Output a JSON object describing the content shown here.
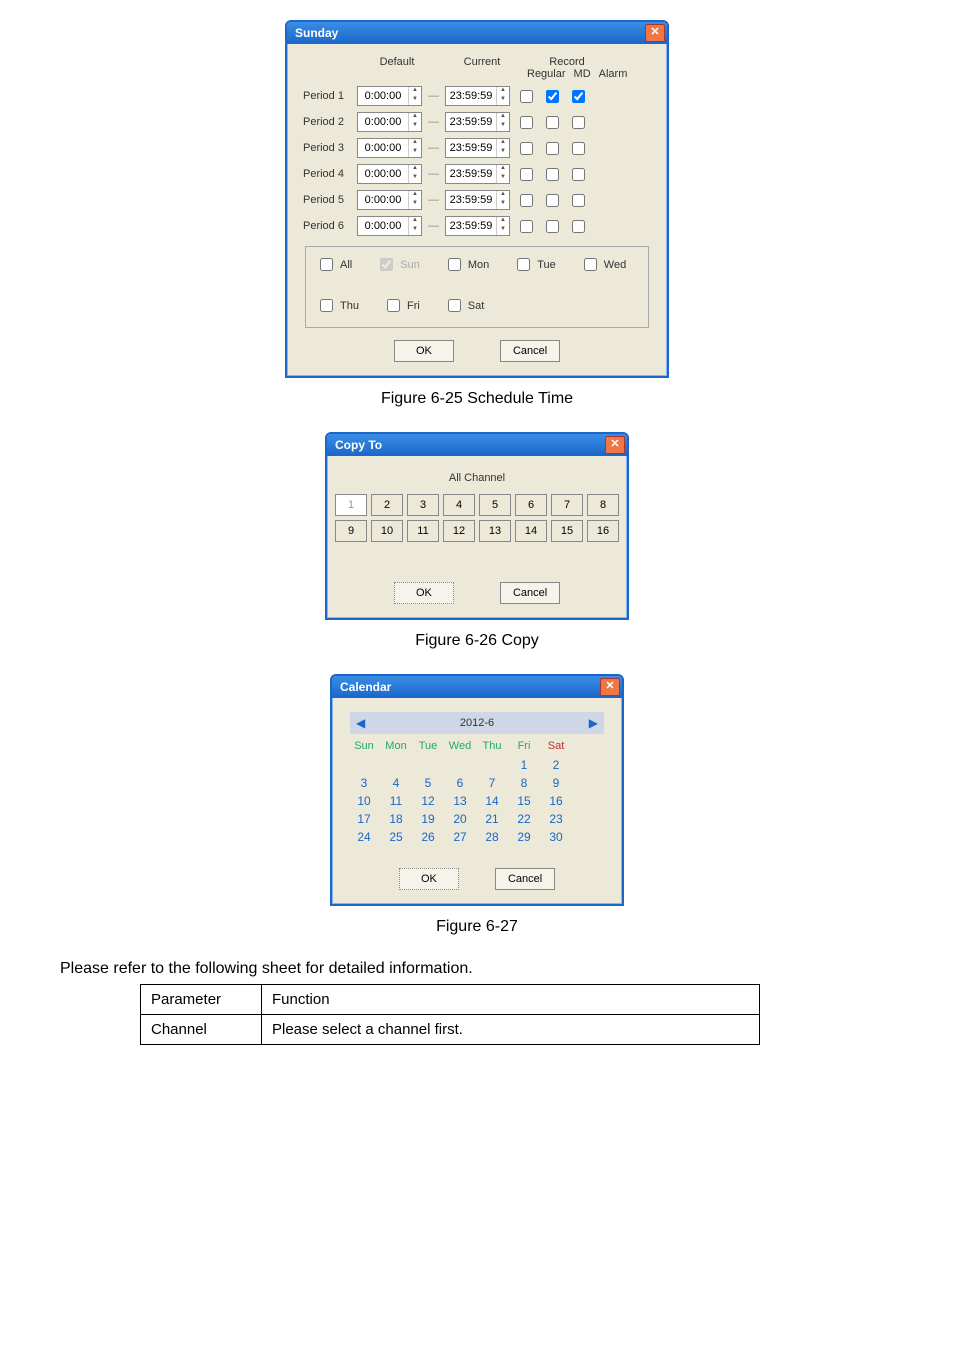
{
  "fig25": {
    "title": "Sunday",
    "cols": {
      "default": "Default",
      "current": "Current",
      "record": "Record",
      "regular": "Regular",
      "md": "MD",
      "alarm": "Alarm"
    },
    "rows": [
      {
        "label": "Period 1",
        "from": "0:00:00",
        "to": "23:59:59",
        "reg": false,
        "md": true,
        "al": true
      },
      {
        "label": "Period 2",
        "from": "0:00:00",
        "to": "23:59:59",
        "reg": false,
        "md": false,
        "al": false
      },
      {
        "label": "Period 3",
        "from": "0:00:00",
        "to": "23:59:59",
        "reg": false,
        "md": false,
        "al": false
      },
      {
        "label": "Period 4",
        "from": "0:00:00",
        "to": "23:59:59",
        "reg": false,
        "md": false,
        "al": false
      },
      {
        "label": "Period 5",
        "from": "0:00:00",
        "to": "23:59:59",
        "reg": false,
        "md": false,
        "al": false
      },
      {
        "label": "Period 6",
        "from": "0:00:00",
        "to": "23:59:59",
        "reg": false,
        "md": false,
        "al": false
      }
    ],
    "days": {
      "all": "All",
      "sun": "Sun",
      "mon": "Mon",
      "tue": "Tue",
      "wed": "Wed",
      "thu": "Thu",
      "fri": "Fri",
      "sat": "Sat"
    },
    "ok": "OK",
    "cancel": "Cancel",
    "caption": "Figure 6-25 Schedule Time"
  },
  "fig26": {
    "title": "Copy To",
    "allch": "All Channel",
    "sel": "1",
    "cells": [
      "1",
      "2",
      "3",
      "4",
      "5",
      "6",
      "7",
      "8",
      "9",
      "10",
      "11",
      "12",
      "13",
      "14",
      "15",
      "16"
    ],
    "ok": "OK",
    "cancel": "Cancel",
    "caption": "Figure 6-26 Copy"
  },
  "fig27": {
    "title": "Calendar",
    "month": "2012-6",
    "hd": [
      "Sun",
      "Mon",
      "Tue",
      "Wed",
      "Thu",
      "Fri",
      "Sat"
    ],
    "ok": "OK",
    "cancel": "Cancel",
    "caption": "Figure 6-27"
  },
  "intro": "Please refer to the following sheet for detailed information.",
  "table": {
    "h_param": "Parameter",
    "h_func": "Function",
    "r1p": "Channel",
    "r1f": "Please select a channel first."
  }
}
